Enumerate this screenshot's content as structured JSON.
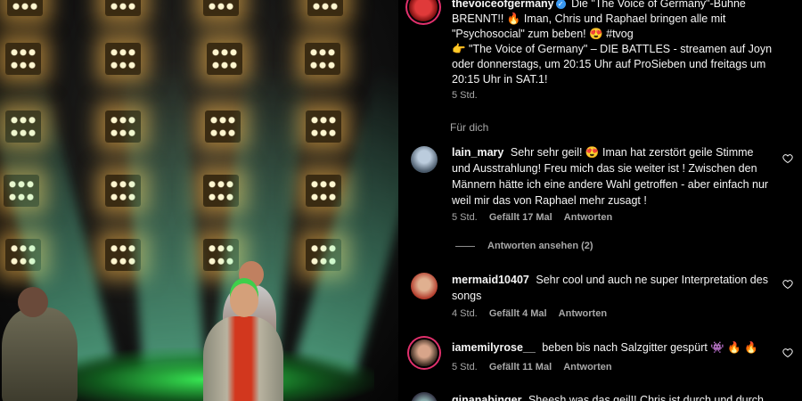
{
  "caption": {
    "username": "thevoiceofgermany",
    "line1": "Die \"The Voice of Germany\"-Bühne BRENNT!! 🔥 Iman, Chris und Raphael bringen alle mit \"Psychosocial\" zum beben! 😍 #tvog",
    "line2": "👉 \"The Voice of Germany\" – DIE BATTLES - streamen auf Joyn oder donnerstags, um 20:15 Uhr auf ProSieben und freitags um 20:15 Uhr in SAT.1!",
    "time": "5 Std.",
    "translate_label": "Für dich"
  },
  "comments": [
    {
      "username": "lain_mary",
      "text": "Sehr sehr geil! 😍 Iman hat zerstört geile Stimme und Ausstrahlung! Freu mich das sie weiter ist ! Zwischen den Männern hätte ich eine andere Wahl getroffen - aber einfach nur weil mir das von Raphael mehr zusagt !",
      "time": "5 Std.",
      "likes": "Gefällt 17 Mal",
      "reply": "Antworten",
      "view_replies": "Antworten ansehen (2)"
    },
    {
      "username": "mermaid10407",
      "text": "Sehr cool und auch ne super Interpretation des songs",
      "time": "4 Std.",
      "likes": "Gefällt 4 Mal",
      "reply": "Antworten"
    },
    {
      "username": "iamemilyrose__",
      "text": "beben bis nach Salzgitter gespürt 👾 🔥 🔥",
      "time": "5 Std.",
      "likes": "Gefällt 11 Mal",
      "reply": "Antworten"
    },
    {
      "username": "ginanabinger",
      "text": "Sheesh was das geil!! Chris ist durch und durch",
      "partial": true
    }
  ],
  "colors": {
    "verified": "#3897f0",
    "ring": "#e1306c",
    "muted": "#a8a8a8"
  },
  "icons": {
    "heart": "heart-outline-icon",
    "verified": "verified-badge-icon"
  }
}
